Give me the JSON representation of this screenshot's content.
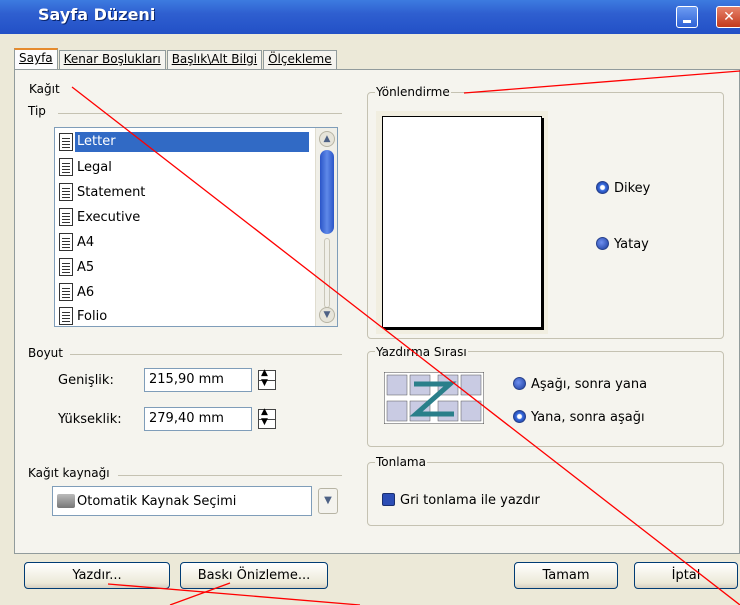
{
  "window": {
    "title": "Sayfa Düzeni"
  },
  "tabs": [
    {
      "label": "Sayfa",
      "active": true
    },
    {
      "label": "Kenar Boşlukları",
      "active": false
    },
    {
      "label": "Başlık\\Alt Bilgi",
      "active": false
    },
    {
      "label": "Ölçekleme",
      "active": false
    }
  ],
  "paper": {
    "group_label": "Kağıt",
    "type_label": "Tip",
    "items": [
      "Letter",
      "Legal",
      "Statement",
      "Executive",
      "A4",
      "A5",
      "A6",
      "Folio"
    ],
    "selected": "Letter",
    "size_label": "Boyut",
    "width_label": "Genişlik:",
    "width_value": "215,90 mm",
    "height_label": "Yükseklik:",
    "height_value": "279,40 mm",
    "source_label": "Kağıt kaynağı",
    "source_value": "Otomatik Kaynak Seçimi"
  },
  "orientation": {
    "group_label": "Yönlendirme",
    "portrait_label": "Dikey",
    "landscape_label": "Yatay",
    "selected": "Dikey"
  },
  "print_order": {
    "group_label": "Yazdırma Sırası",
    "down_then_across": "Aşağı, sonra yana",
    "across_then_down": "Yana, sonra aşağı",
    "selected": "Yana, sonra aşağı"
  },
  "shading": {
    "group_label": "Tonlama",
    "grayscale_label": "Gri tonlama ile yazdır",
    "checked": true
  },
  "buttons": {
    "print": "Yazdır...",
    "preview": "Baskı Önizleme...",
    "ok": "Tamam",
    "cancel": "İptal"
  },
  "colors": {
    "title_bar": "#2250c6",
    "selection": "#316ac5",
    "annotation": "#ff0000"
  }
}
